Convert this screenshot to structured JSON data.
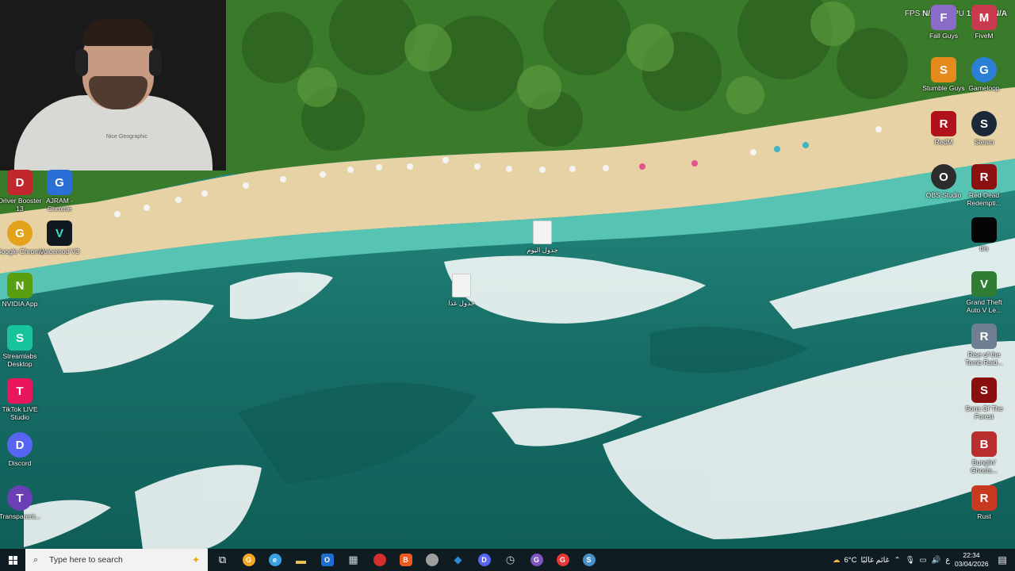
{
  "overlay": {
    "fps_label": "FPS",
    "fps_value": "N/A",
    "gpu_label": "GPU",
    "gpu_value": "19%",
    "cpu_value": "N/A"
  },
  "webcam": {
    "shirt_text": "Nice Geographic"
  },
  "desktop": {
    "left_icons": [
      {
        "label": "Driver Booster 13",
        "color": "#c1272d",
        "glyph": "D"
      },
      {
        "label": "AJRAM - Chrome",
        "color": "#2a6fd6",
        "glyph": "G"
      },
      {
        "label": "Google Chrome",
        "color": "#e3a21a",
        "glyph": "G"
      },
      {
        "label": "Voicemod V3",
        "color": "#101820",
        "glyph": "V"
      },
      {
        "label": "NVIDIA App",
        "color": "#5a9e12",
        "glyph": "N"
      },
      {
        "label": "Streamlabs Desktop",
        "color": "#19c39c",
        "glyph": "S"
      },
      {
        "label": "TikTok LIVE Studio",
        "color": "#e8175d",
        "glyph": "T"
      },
      {
        "label": "Discord",
        "color": "#5865f2",
        "glyph": "D"
      },
      {
        "label": "Transparent...",
        "color": "#6a3fb5",
        "glyph": "T"
      }
    ],
    "right_icons": [
      {
        "label": "Fall Guys",
        "color": "#8a6bc8",
        "glyph": "F"
      },
      {
        "label": "FiveM",
        "color": "#c93a4e",
        "glyph": "M"
      },
      {
        "label": "Stumble Guys",
        "color": "#e48b1c",
        "glyph": "S"
      },
      {
        "label": "Gameloop",
        "color": "#2b7fd4",
        "glyph": "G"
      },
      {
        "label": "RedM",
        "color": "#b0121c",
        "glyph": "R"
      },
      {
        "label": "Steam",
        "color": "#1b2838",
        "glyph": "S"
      },
      {
        "label": "OBS Studio",
        "color": "#2d2d2d",
        "glyph": "O"
      },
      {
        "label": "Red Dead Redempti...",
        "color": "#8b1111",
        "glyph": "R"
      },
      {
        "label": "bls",
        "color": "#050505",
        "glyph": ""
      },
      {
        "label": "Grand Theft Auto V Le...",
        "color": "#2e7d32",
        "glyph": "V"
      },
      {
        "label": "Rise of the Tomb Raid...",
        "color": "#6e7f93",
        "glyph": "R"
      },
      {
        "label": "Sons Of The Forest",
        "color": "#8b0e0e",
        "glyph": "S"
      },
      {
        "label": "Bunglin' Ghosts...",
        "color": "#b82d2d",
        "glyph": "B"
      },
      {
        "label": "Rust",
        "color": "#c8391f",
        "glyph": "R"
      }
    ],
    "files": [
      {
        "label": "جدول اليوم"
      },
      {
        "label": "جدول غدا"
      }
    ]
  },
  "taskbar": {
    "search_placeholder": "Type here to search",
    "apps": [
      {
        "name": "task-view",
        "glyph": "⧉",
        "color": "#ffffff"
      },
      {
        "name": "chrome-canary",
        "glyph": "G",
        "color": "#f5a623"
      },
      {
        "name": "edge",
        "glyph": "e",
        "color": "#3aa0e4"
      },
      {
        "name": "file-explorer",
        "glyph": "▬",
        "color": "#f2c14e"
      },
      {
        "name": "outlook",
        "glyph": "O",
        "color": "#1f6fd1"
      },
      {
        "name": "calculator",
        "glyph": "▦",
        "color": "#cfd8dc"
      },
      {
        "name": "app-red",
        "glyph": "●",
        "color": "#d32f2f"
      },
      {
        "name": "brave",
        "glyph": "B",
        "color": "#ef5a24"
      },
      {
        "name": "app-grey",
        "glyph": "◉",
        "color": "#9e9e9e"
      },
      {
        "name": "vscode",
        "glyph": "◆",
        "color": "#2a8dd4"
      },
      {
        "name": "discord",
        "glyph": "D",
        "color": "#5865f2"
      },
      {
        "name": "app-clock",
        "glyph": "◷",
        "color": "#cfcfcf"
      },
      {
        "name": "chrome-profile",
        "glyph": "G",
        "color": "#7e57c2"
      },
      {
        "name": "chrome",
        "glyph": "G",
        "color": "#e53935"
      },
      {
        "name": "steam",
        "glyph": "S",
        "color": "#4a90c8"
      }
    ],
    "weather": "6°C",
    "weather_text": "غائم غالبًا",
    "lang": "ع",
    "time": "22:34",
    "date": "03/04/2026"
  }
}
